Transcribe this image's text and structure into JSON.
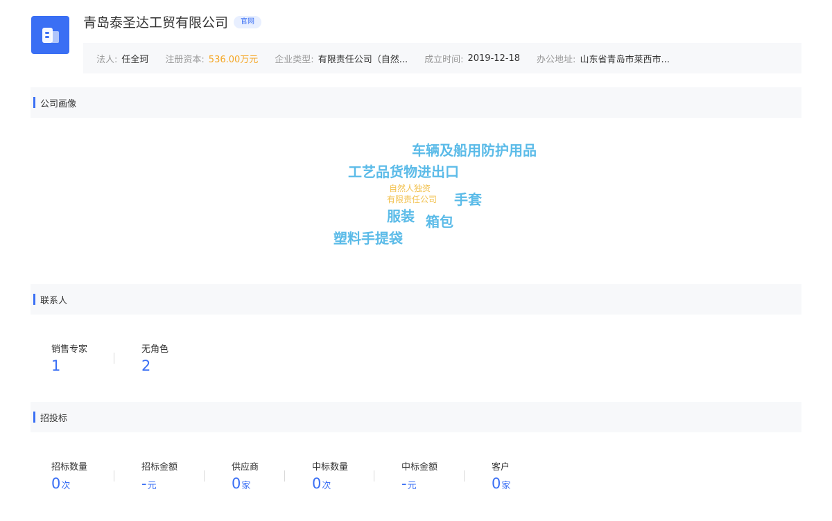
{
  "company": {
    "name": "青岛泰圣达工贸有限公司",
    "official_site_label": "官网"
  },
  "info": [
    {
      "label": "法人:",
      "value": "任全珂",
      "accent": false
    },
    {
      "label": "注册资本:",
      "value": "536.00万元",
      "accent": true
    },
    {
      "label": "企业类型:",
      "value": "有限责任公司（自然...",
      "accent": false
    },
    {
      "label": "成立时间:",
      "value": "2019-12-18",
      "accent": false
    },
    {
      "label": "办公地址:",
      "value": "山东省青岛市莱西市...",
      "accent": false
    }
  ],
  "sections": {
    "portrait": "公司画像",
    "contacts": "联系人",
    "bidding": "招投标"
  },
  "word_cloud": [
    {
      "text": "车辆及船用防护用品",
      "color": "#5bbbe8"
    },
    {
      "text": "工艺品货物进出口",
      "color": "#5bbbe8"
    },
    {
      "text": "自然人独资",
      "color": "#f2c14e"
    },
    {
      "text": "有限责任公司",
      "color": "#f2c14e"
    },
    {
      "text": "手套",
      "color": "#5bbbe8"
    },
    {
      "text": "服装",
      "color": "#5bbbe8"
    },
    {
      "text": "箱包",
      "color": "#5bbbe8"
    },
    {
      "text": "塑料手提袋",
      "color": "#5bbbe8"
    }
  ],
  "contacts": [
    {
      "label": "销售专家",
      "value": "1"
    },
    {
      "label": "无角色",
      "value": "2"
    }
  ],
  "bidding": [
    {
      "label": "招标数量",
      "value": "0",
      "unit": "次"
    },
    {
      "label": "招标金额",
      "value": "-",
      "unit": "元"
    },
    {
      "label": "供应商",
      "value": "0",
      "unit": "家"
    },
    {
      "label": "中标数量",
      "value": "0",
      "unit": "次"
    },
    {
      "label": "中标金额",
      "value": "-",
      "unit": "元"
    },
    {
      "label": "客户",
      "value": "0",
      "unit": "家"
    }
  ]
}
